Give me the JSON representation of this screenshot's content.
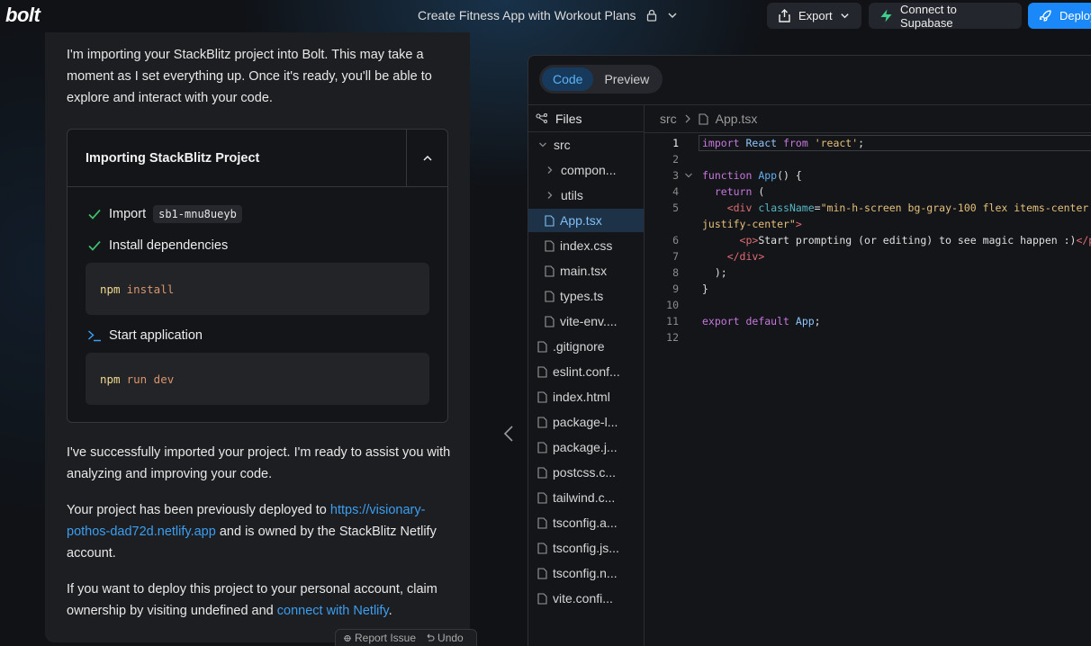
{
  "header": {
    "logo": "bolt",
    "project_title": "Create Fitness App with Workout Plans",
    "export_label": "Export",
    "supabase_label": "Connect to Supabase",
    "deploy_label": "Deploy"
  },
  "chat": {
    "intro": "I'm importing your StackBlitz project into Bolt. This may take a moment as I set everything up. Once it's ready, you'll be able to explore and interact with your code.",
    "card_title": "Importing StackBlitz Project",
    "step_import_label": "Import",
    "step_import_id": "sb1-mnu8ueyb",
    "step_install_label": "Install dependencies",
    "install_cmd_1": "npm",
    "install_cmd_2": "install",
    "step_start_label": "Start application",
    "start_cmd_1": "npm",
    "start_cmd_2": "run dev",
    "success_msg": "I've successfully imported your project. I'm ready to assist you with analyzing and improving your code.",
    "deploy_msg_1": "Your project has been previously deployed to",
    "deploy_link": "https://visionary-pothos-dad72d.netlify.app",
    "deploy_msg_2": "and is owned by the StackBlitz Netlify account.",
    "claim_msg_1": "If you want to deploy this project to your personal account, claim ownership by visiting undefined and",
    "claim_link": "connect with Netlify",
    "claim_msg_2": ".",
    "report_issue": "Report Issue",
    "undo": "Undo"
  },
  "editor": {
    "tabs": [
      "Code",
      "Preview"
    ],
    "files_label": "Files",
    "breadcrumb_folder": "src",
    "breadcrumb_file": "App.tsx",
    "tree": [
      {
        "name": "src",
        "type": "folder-open",
        "depth": 0
      },
      {
        "name": "compon...",
        "type": "folder",
        "depth": 1
      },
      {
        "name": "utils",
        "type": "folder",
        "depth": 1
      },
      {
        "name": "App.tsx",
        "type": "file",
        "depth": 1,
        "selected": true
      },
      {
        "name": "index.css",
        "type": "file",
        "depth": 1
      },
      {
        "name": "main.tsx",
        "type": "file",
        "depth": 1
      },
      {
        "name": "types.ts",
        "type": "file",
        "depth": 1
      },
      {
        "name": "vite-env....",
        "type": "file",
        "depth": 1
      },
      {
        "name": ".gitignore",
        "type": "file",
        "depth": 0
      },
      {
        "name": "eslint.conf...",
        "type": "file",
        "depth": 0
      },
      {
        "name": "index.html",
        "type": "file",
        "depth": 0
      },
      {
        "name": "package-l...",
        "type": "file",
        "depth": 0
      },
      {
        "name": "package.j...",
        "type": "file",
        "depth": 0
      },
      {
        "name": "postcss.c...",
        "type": "file",
        "depth": 0
      },
      {
        "name": "tailwind.c...",
        "type": "file",
        "depth": 0
      },
      {
        "name": "tsconfig.a...",
        "type": "file",
        "depth": 0
      },
      {
        "name": "tsconfig.js...",
        "type": "file",
        "depth": 0
      },
      {
        "name": "tsconfig.n...",
        "type": "file",
        "depth": 0
      },
      {
        "name": "vite.confi...",
        "type": "file",
        "depth": 0
      }
    ],
    "code_lines": [
      {
        "n": "1",
        "fold": "",
        "html": "<span class='k'>import</span> <span class='id'>React</span> <span class='k'>from</span> <span class='s'>'react'</span>;"
      },
      {
        "n": "2",
        "fold": "",
        "html": ""
      },
      {
        "n": "3",
        "fold": "v",
        "html": "<span class='k'>function</span> <span class='f'>App</span>() {"
      },
      {
        "n": "4",
        "fold": "",
        "html": "  <span class='k'>return</span> ("
      },
      {
        "n": "5",
        "fold": "",
        "html": "    <span class='t'>&lt;div</span> <span class='a'>className</span>=<span class='s'>\"min-h-screen bg-gray-100 flex items-center</span>"
      },
      {
        "n": "",
        "fold": "",
        "html": "<span class='s'>justify-center\"</span><span class='t'>&gt;</span>"
      },
      {
        "n": "6",
        "fold": "",
        "html": "      <span class='t'>&lt;p&gt;</span>Start prompting (or editing) to see magic happen :)<span class='t'>&lt;/p&gt;</span>"
      },
      {
        "n": "7",
        "fold": "",
        "html": "    <span class='t'>&lt;/div&gt;</span>"
      },
      {
        "n": "8",
        "fold": "",
        "html": "  );"
      },
      {
        "n": "9",
        "fold": "",
        "html": "}"
      },
      {
        "n": "10",
        "fold": "",
        "html": ""
      },
      {
        "n": "11",
        "fold": "",
        "html": "<span class='k'>export</span> <span class='k'>default</span> <span class='id'>App</span>;"
      },
      {
        "n": "12",
        "fold": "",
        "html": ""
      }
    ]
  },
  "colors": {
    "accent": "#1a88f8",
    "link": "#3b9ef0",
    "check": "#3fbf6c",
    "supabase": "#3ecf8e"
  }
}
